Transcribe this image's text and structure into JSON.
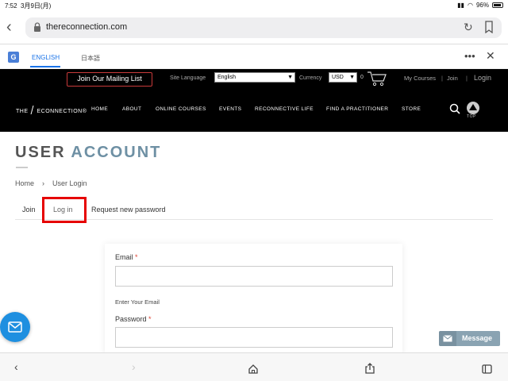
{
  "status_bar": {
    "time": "7:52",
    "date": "3月9日(月)",
    "battery": "96%"
  },
  "browser": {
    "url": "thereconnection.com"
  },
  "translate_bar": {
    "tab_english": "ENGLISH",
    "tab_japanese": "日本語"
  },
  "header": {
    "mailing_list": "Join Our Mailing List",
    "site_language_label": "Site Language",
    "site_language_value": "English",
    "currency_label": "Currency",
    "currency_value": "USD",
    "cart_count": "0",
    "my_courses": "My Courses",
    "join": "Join",
    "login": "Login",
    "separator": "|",
    "logo_prefix": "THE",
    "logo_suffix": "ECONNECTION",
    "logo_reg": "®",
    "top_label": "TOP",
    "nav": {
      "home": "HOME",
      "about": "ABOUT",
      "online_courses": "ONLINE COURSES",
      "events": "EVENTS",
      "reconnective_life": "RECONNECTIVE LIFE",
      "find_practitioner": "FIND A PRACTITIONER",
      "store": "STORE"
    }
  },
  "page": {
    "title_part1": "USER",
    "title_part2": "ACCOUNT",
    "breadcrumb": {
      "home": "Home",
      "separator": "›",
      "current": "User Login"
    },
    "tabs": {
      "join": "Join",
      "login": "Log in",
      "request_password": "Request new password"
    }
  },
  "form": {
    "email_label": "Email",
    "required_mark": "*",
    "email_value": "",
    "email_help": "Enter Your Email",
    "password_label": "Password",
    "password_value": ""
  },
  "widgets": {
    "message_label": "Message"
  },
  "colors": {
    "accent": "#6e90a4",
    "highlight_box": "#e60000",
    "fab": "#1e8fe0"
  }
}
